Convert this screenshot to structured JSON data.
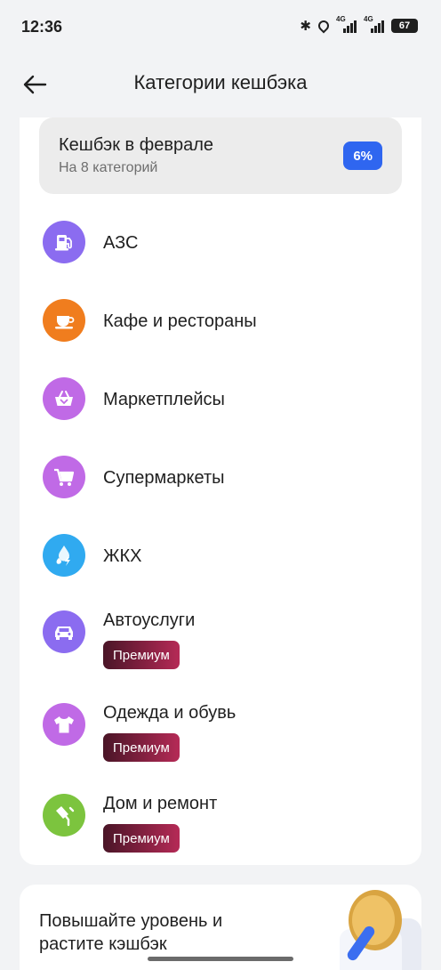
{
  "status_bar": {
    "time": "12:36",
    "network_1": "4G",
    "network_2": "4G",
    "battery": "67"
  },
  "header": {
    "title": "Категории кешбэка"
  },
  "summary": {
    "title": "Кешбэк в феврале",
    "subtitle": "На 8 категорий",
    "percent": "6%",
    "badge_color": "#2f66f0"
  },
  "categories": [
    {
      "label": "АЗС",
      "icon": "fuel-pump-icon",
      "color": "#8b6cf0",
      "premium": ""
    },
    {
      "label": "Кафе и рестораны",
      "icon": "cup-icon",
      "color": "#f07d1e",
      "premium": ""
    },
    {
      "label": "Маркетплейсы",
      "icon": "basket-icon",
      "color": "#c06ae6",
      "premium": ""
    },
    {
      "label": "Супермаркеты",
      "icon": "shopping-cart-icon",
      "color": "#c06ae6",
      "premium": ""
    },
    {
      "label": "ЖКХ",
      "icon": "utilities-icon",
      "color": "#30aaf0",
      "premium": ""
    },
    {
      "label": "Автоуслуги",
      "icon": "car-icon",
      "color": "#8b6cf0",
      "premium": "Премиум"
    },
    {
      "label": "Одежда и обувь",
      "icon": "tshirt-icon",
      "color": "#c06ae6",
      "premium": "Премиум"
    },
    {
      "label": "Дом и ремонт",
      "icon": "paint-roller-icon",
      "color": "#7cc43e",
      "premium": "Премиум"
    }
  ],
  "promo": {
    "text": "Повышайте уровень и растите кэшбэк"
  }
}
